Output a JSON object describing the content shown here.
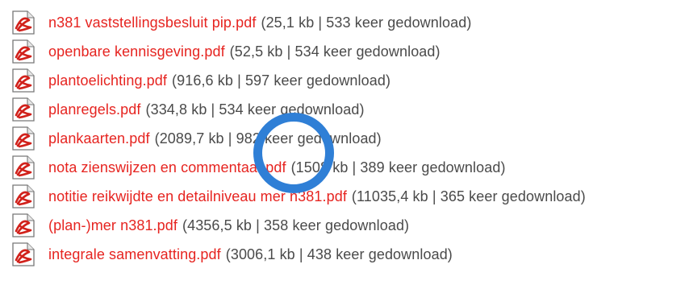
{
  "icons": {
    "file_type": "pdf-icon"
  },
  "colors": {
    "link": "#e62420",
    "meta": "#4a4a4a",
    "pdf_icon_red": "#d1211b",
    "highlight_circle": "#2f7fd6"
  },
  "files": [
    {
      "name": "n381 vaststellingsbesluit pip.pdf",
      "meta": "(25,1 kb | 533 keer gedownload)"
    },
    {
      "name": "openbare kennisgeving.pdf",
      "meta": "(52,5 kb | 534 keer gedownload)"
    },
    {
      "name": "plantoelichting.pdf",
      "meta": "(916,6 kb | 597 keer gedownload)"
    },
    {
      "name": "planregels.pdf",
      "meta": "(334,8 kb | 534 keer gedownload)"
    },
    {
      "name": "plankaarten.pdf",
      "meta": "(2089,7 kb | 982 keer gedownload)"
    },
    {
      "name": "nota zienswijzen en commentaar.pdf",
      "meta": "(1508 kb | 389 keer gedownload)"
    },
    {
      "name": "notitie reikwijdte en detailniveau mer n381.pdf",
      "meta": "(11035,4 kb | 365 keer gedownload)"
    },
    {
      "name": "(plan-)mer n381.pdf",
      "meta": "(4356,5 kb | 358 keer gedownload)"
    },
    {
      "name": "integrale samenvatting.pdf",
      "meta": "(3006,1 kb | 438 keer gedownload)"
    }
  ]
}
